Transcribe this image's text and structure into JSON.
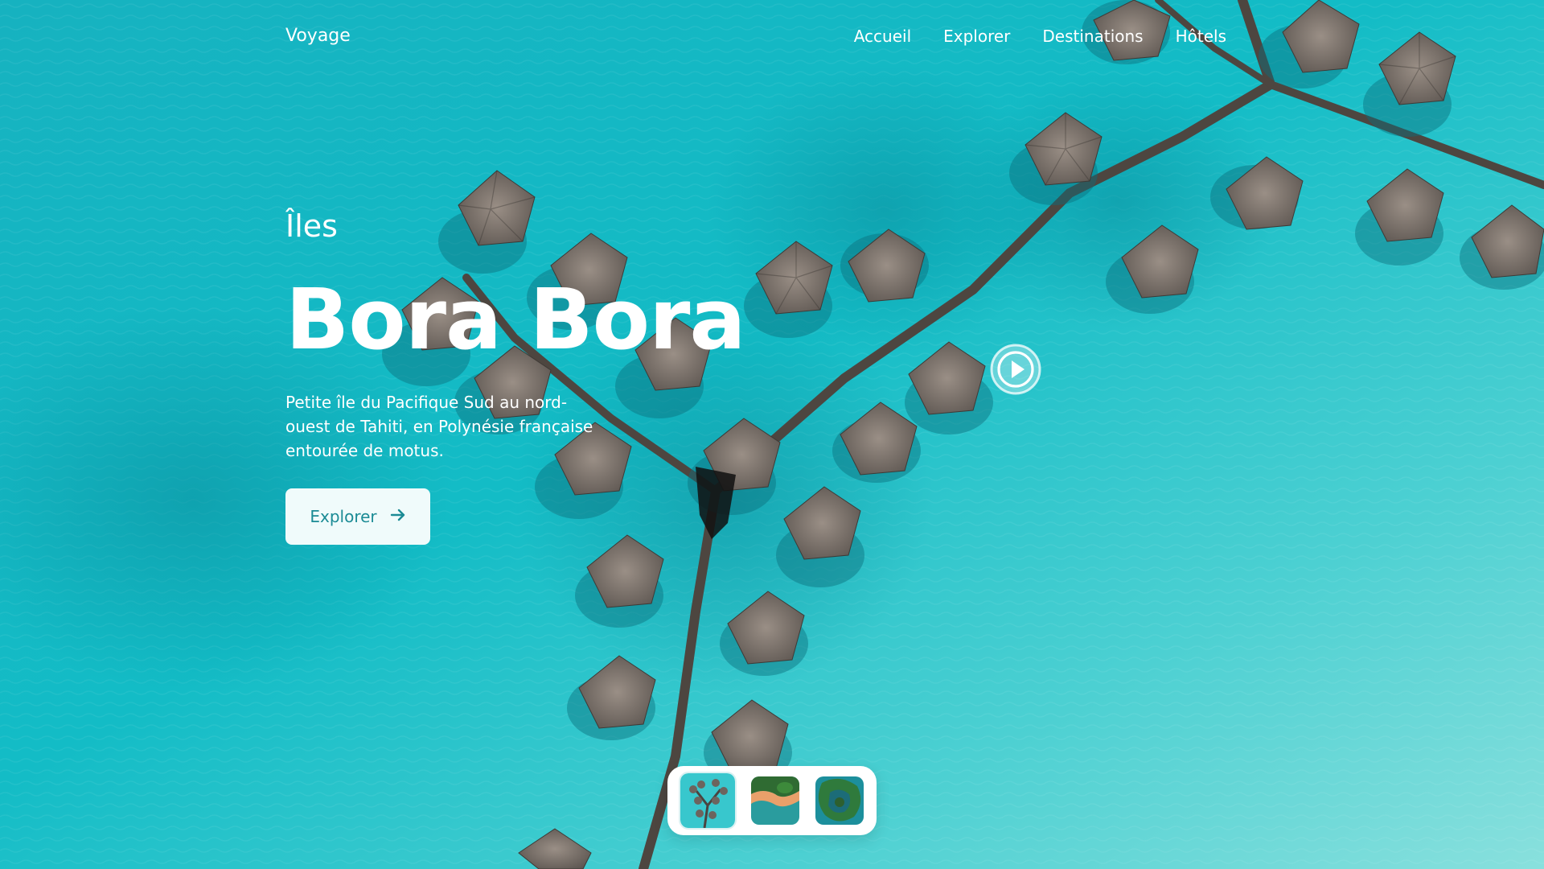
{
  "brand": {
    "name": "Voyage"
  },
  "nav": {
    "items": [
      {
        "label": "Accueil"
      },
      {
        "label": "Explorer"
      },
      {
        "label": "Destinations"
      },
      {
        "label": "Hôtels"
      }
    ]
  },
  "hero": {
    "subtitle": "Îles",
    "title": "Bora Bora",
    "description": "Petite île du Pacifique Sud au nord-ouest de Tahiti, en Polynésie française entourée de motus.",
    "cta_label": "Explorer",
    "cta_icon": "arrow-right-icon"
  },
  "media": {
    "play_icon": "play-icon",
    "thumbnails": [
      {
        "name": "overwater-bungalows-thumbnail"
      },
      {
        "name": "island-beach-thumbnail"
      },
      {
        "name": "island-aerial-thumbnail"
      }
    ]
  },
  "colors": {
    "lagoon": "#19b9c3",
    "button_bg": "#f0fbfb",
    "button_text": "#1b8b95",
    "text": "#ffffff"
  }
}
